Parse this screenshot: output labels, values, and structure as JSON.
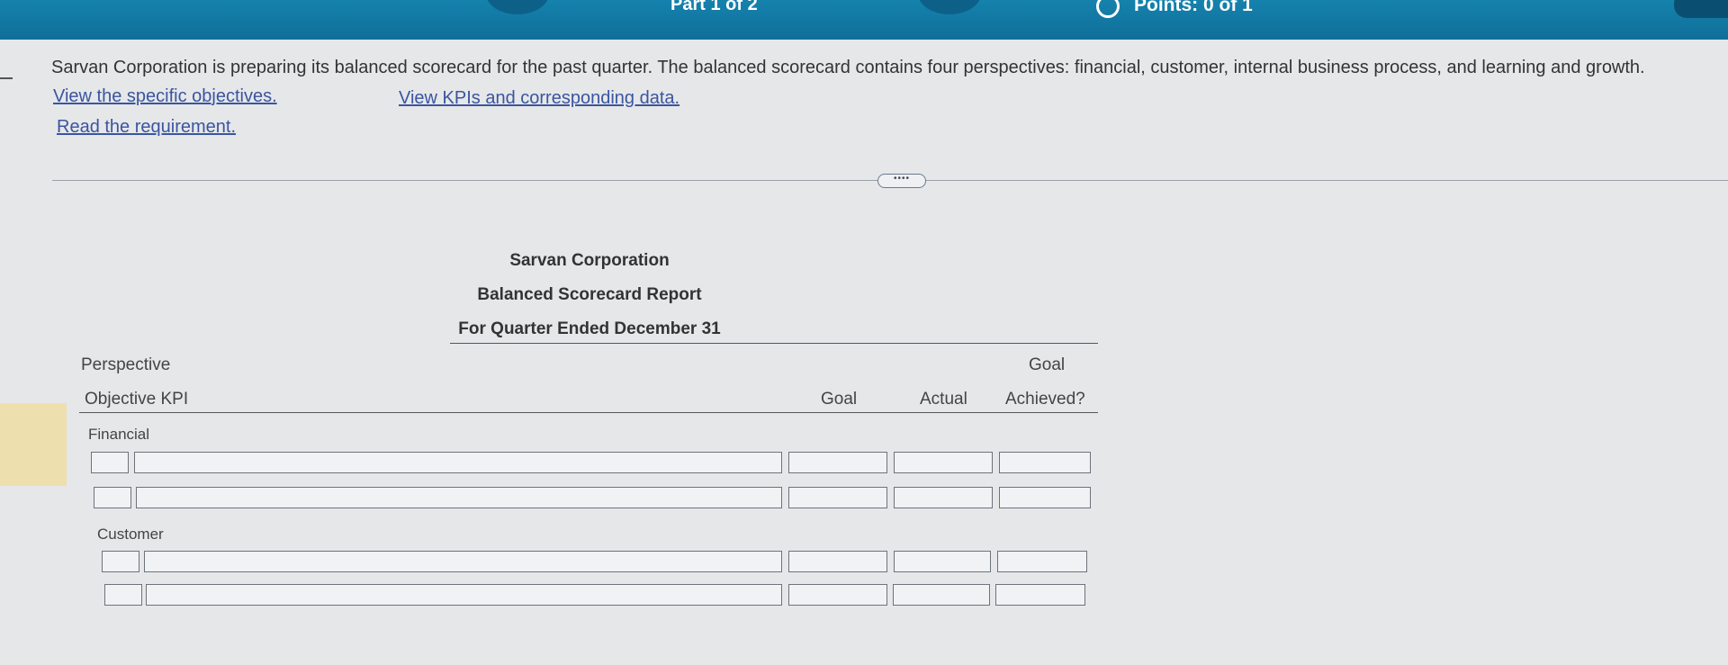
{
  "topbar": {
    "part": "Part 1 of 2",
    "points": "Points: 0 of 1"
  },
  "question": {
    "text": "Sarvan Corporation is preparing its balanced scorecard for the past quarter. The balanced scorecard contains four perspectives: financial, customer, internal business process, and learning and growth.",
    "link_objectives": "View the specific objectives.",
    "link_kpis": "View KPIs and corresponding data.",
    "link_requirement": "Read the requirement."
  },
  "more_button": "••••",
  "report": {
    "company": "Sarvan Corporation",
    "title": "Balanced Scorecard Report",
    "period": "For Quarter Ended December 31"
  },
  "table": {
    "perspective_header": "Perspective",
    "objective_header": "Objective KPI",
    "goal_header": "Goal",
    "actual_header": "Actual",
    "achieved_header_top": "Goal",
    "achieved_header_bottom": "Achieved?",
    "sections": [
      {
        "label": "Financial"
      },
      {
        "label": "Customer"
      }
    ]
  }
}
